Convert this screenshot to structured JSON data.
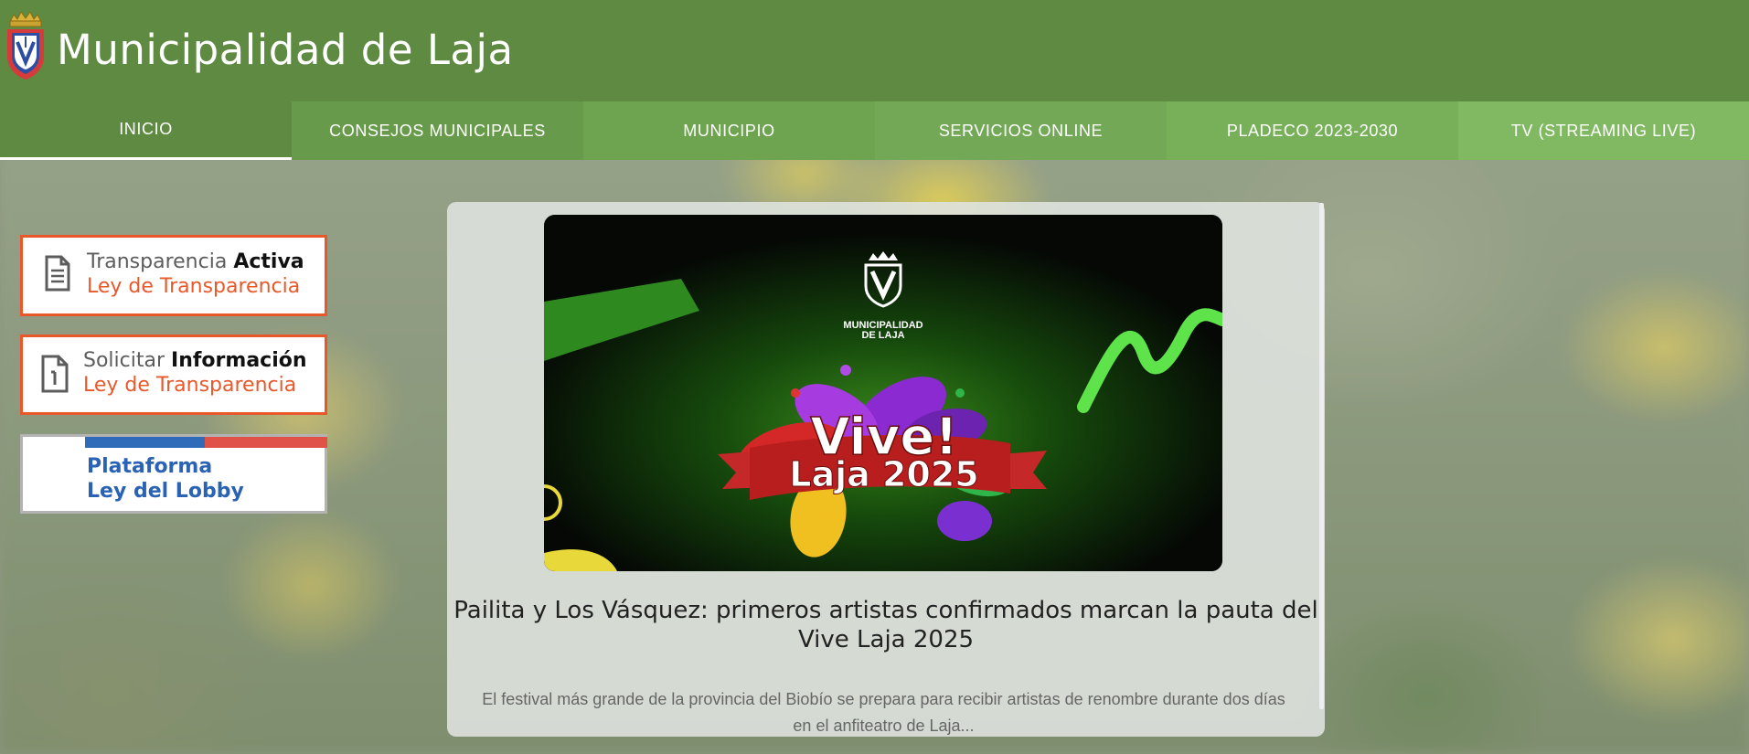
{
  "header": {
    "title": "Municipalidad de Laja"
  },
  "nav": {
    "items": [
      {
        "label": "INICIO",
        "color": "#5e8a42"
      },
      {
        "label": "CONSEJOS MUNICIPALES",
        "color": "#689a4b"
      },
      {
        "label": "MUNICIPIO",
        "color": "#6ea350"
      },
      {
        "label": "SERVICIOS ONLINE",
        "color": "#73a956"
      },
      {
        "label": "PLADECO 2023-2030",
        "color": "#78b05a"
      },
      {
        "label": "TV (STREAMING LIVE)",
        "color": "#80b962"
      }
    ]
  },
  "side_links": {
    "transparencia": {
      "line1_light": "Transparencia",
      "line1_bold": "Activa",
      "line2": "Ley de Transparencia"
    },
    "solicitar": {
      "line1_light": "Solicitar",
      "line1_bold": "Información",
      "line2": "Ley de Transparencia"
    },
    "lobby": {
      "line1": "Plataforma",
      "line2": "Ley del Lobby"
    }
  },
  "news": {
    "image_logo_text_1": "MUNICIPALIDAD",
    "image_logo_text_2": "DE LAJA",
    "image_banner_1": "Vive!",
    "image_banner_2": "Laja 2025",
    "title": "Pailita y Los Vásquez: primeros artistas confirmados marcan la pauta del Vive Laja 2025",
    "excerpt": "El festival más grande de la provincia del Biobío se prepara para recibir artistas de renombre durante dos días en el anfiteatro de Laja..."
  },
  "colors": {
    "header_bg": "#5e8a42",
    "accent_orange": "#e8582a",
    "lobby_blue": "#2a62b4",
    "lobby_red": "#e05248"
  }
}
